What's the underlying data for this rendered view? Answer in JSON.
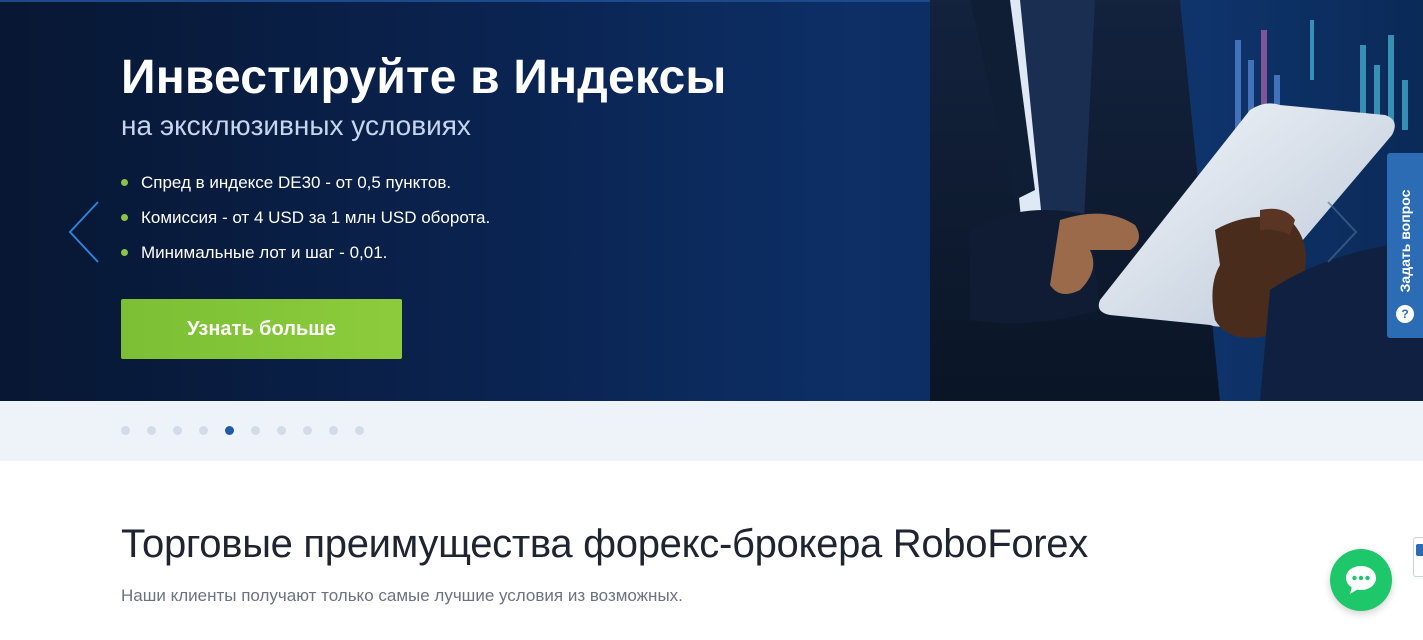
{
  "hero": {
    "title": "Инвестируйте в Индексы",
    "subtitle": "на эксклюзивных условиях",
    "bullets": [
      "Спред в индексе DE30 - от 0,5 пунктов.",
      "Комиссия - от 4 USD за 1 млн USD оборота.",
      "Минимальные лот и шаг - 0,01."
    ],
    "cta_label": "Узнать больше",
    "prev_icon": "chevron-left-icon",
    "next_icon": "chevron-right-icon",
    "image": "businessman-holding-tablet-photo"
  },
  "ask_question": {
    "label": "Задать вопрос",
    "icon_glyph": "?",
    "icon": "question-circle-icon"
  },
  "slider": {
    "slide_count": 10,
    "active_index": 4
  },
  "advantages": {
    "title": "Торговые преимущества форекс-брокера RoboForex",
    "subtitle": "Наши клиенты получают только самые лучшие условия из возможных."
  },
  "chat": {
    "icon": "chat-bubble-icon"
  },
  "colors": {
    "accent_green": "#8bc34a",
    "button_green": "#7cbf35",
    "brand_blue": "#2b6cb4",
    "chat_green": "#1ec769",
    "hero_bg": "#0a2350"
  }
}
